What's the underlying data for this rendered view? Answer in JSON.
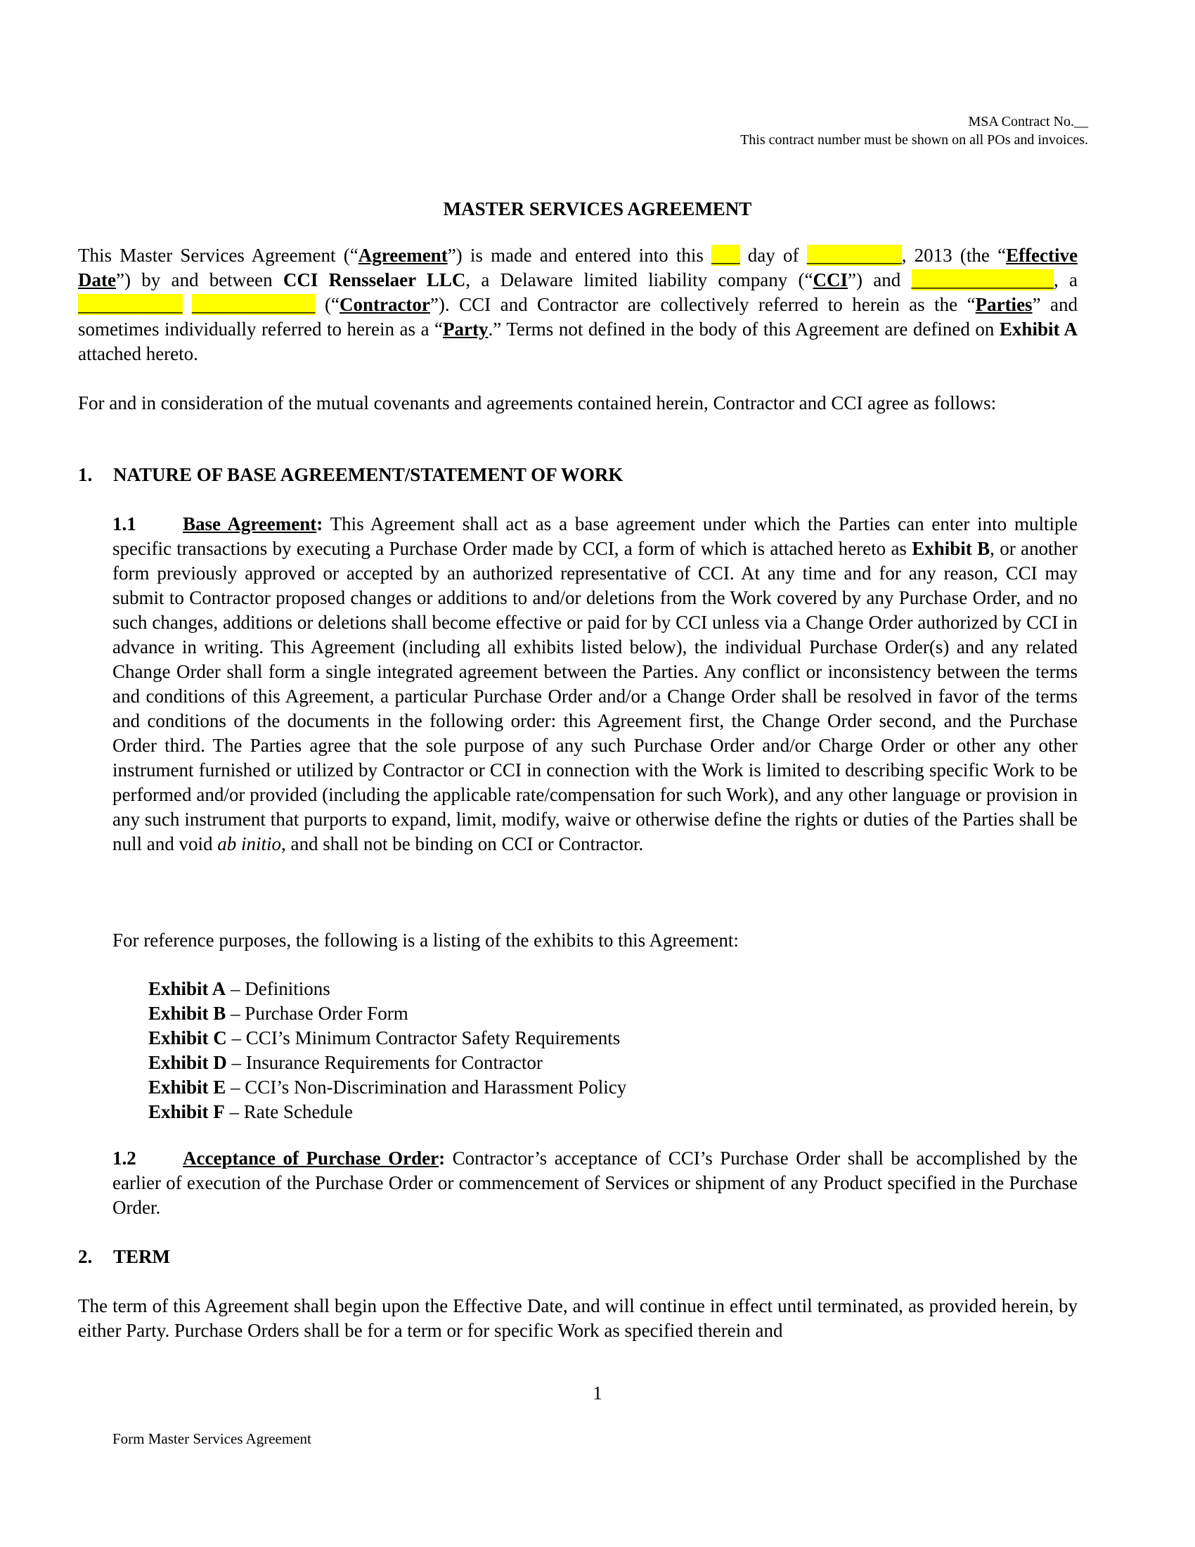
{
  "header": {
    "contract_no": "MSA Contract No.__",
    "contract_note": "This contract number must be shown on all POs and invoices."
  },
  "title": "MASTER SERVICES AGREEMENT",
  "intro": {
    "t1": "This Master Services Agreement (“",
    "agreement_term": "Agreement",
    "t2": "”) is made and entered into this ",
    "day_blank": "___",
    "t3": " day of ",
    "month_blank": "__________",
    "t4": ", 2013 (the “",
    "effective_date_term": "Effective Date",
    "t5": "”) by and between ",
    "cci_name": "CCI Rensselaer LLC",
    "t6": ", a Delaware limited liability company (“",
    "cci_term": "CCI",
    "t7": "”) and ",
    "contractor_name_blank": "_______________",
    "t8": ", a ",
    "state_blank": "___________",
    "t9": " ",
    "entity_type_blank": "_____________",
    "t10": " (“",
    "contractor_term": "Contractor",
    "t11": "”). CCI and Contractor are collectively referred to herein as the “",
    "parties_term": "Parties",
    "t12": "” and sometimes individually referred to herein as a “",
    "party_term": "Party",
    "t13": ".” Terms not defined in the body of this Agreement are defined on ",
    "exhibit_a": "Exhibit A",
    "t14": " attached hereto."
  },
  "consideration": "For and in consideration of the mutual covenants and agreements contained herein, Contractor and CCI agree as follows:",
  "section1": {
    "number": "1.",
    "heading": "NATURE OF BASE AGREEMENT/STATEMENT OF WORK",
    "s11": {
      "number": "1.1",
      "heading": "Base Agreement",
      "colon": ":",
      "t1": "  This Agreement shall act as a base agreement under which the Parties can enter into multiple specific transactions by executing a Purchase Order made by CCI, a form of which is attached hereto as ",
      "exhibit_b": "Exhibit B",
      "t2": ", or another form previously approved or accepted by an authorized representative of CCI.  At any time and for any reason, CCI may submit to Contractor proposed changes or additions to and/or deletions from the Work covered by any Purchase Order, and no such changes, additions or deletions shall become effective or paid for by CCI unless via a Change Order authorized by CCI in advance in writing.  This Agreement (including all exhibits listed below), the individual Purchase Order(s) and any related Change Order shall form a single integrated agreement between the Parties. Any conflict or inconsistency between the terms and conditions of this Agreement, a particular Purchase Order and/or a Change Order shall be resolved in favor of the terms and conditions of the documents in the following order: this Agreement first, the Change Order second, and the Purchase Order third.  The Parties agree that the sole purpose of any such Purchase Order and/or Charge Order or other any other instrument furnished or utilized by Contractor or CCI in connection with the Work is limited to describing specific Work to be performed and/or provided (including the applicable rate/compensation for such Work), and any other language or provision in any such instrument that purports to expand, limit, modify, waive or otherwise define the rights or duties of the Parties shall be null and void ",
      "italic": "ab initio",
      "t3": ", and shall not be binding on CCI or Contractor."
    },
    "reference_text": "For reference purposes, the following is a listing of the exhibits to this Agreement:",
    "exhibits": [
      {
        "label": "Exhibit A",
        "desc": " – Definitions"
      },
      {
        "label": "Exhibit B",
        "desc": " – Purchase Order Form"
      },
      {
        "label": "Exhibit C",
        "desc": " – CCI’s Minimum Contractor Safety Requirements"
      },
      {
        "label": "Exhibit D",
        "desc": " – Insurance Requirements for Contractor"
      },
      {
        "label": "Exhibit E",
        "desc": " – CCI’s Non-Discrimination and Harassment Policy"
      },
      {
        "label": "Exhibit F",
        "desc": " – Rate Schedule"
      }
    ],
    "s12": {
      "number": "1.2",
      "heading": "Acceptance of Purchase Order",
      "colon": ":",
      "text": "  Contractor’s acceptance of CCI’s Purchase Order shall be accomplished by the earlier of execution of the Purchase Order or commencement of Services or shipment of any Product specified in the Purchase Order."
    }
  },
  "section2": {
    "number": "2.",
    "heading": "TERM",
    "text": "The term of this Agreement shall begin upon the Effective Date, and will continue in effect until terminated, as provided herein, by either Party.  Purchase Orders shall be for a term or for specific Work as specified therein and"
  },
  "page_number": "1",
  "footer": "Form Master Services Agreement",
  "colors": {
    "highlight": "#ffff00",
    "text": "#000000",
    "background": "#ffffff"
  }
}
